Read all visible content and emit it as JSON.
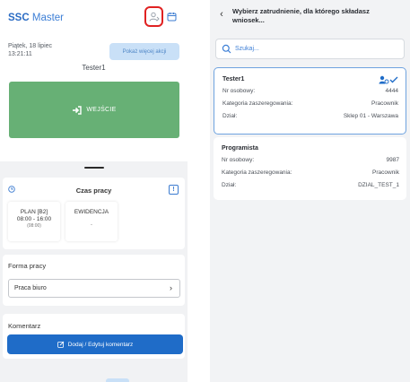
{
  "left_screen": {
    "brand_bold": "SSC",
    "brand_light": "Master",
    "date": "Piątek, 18 lipiec",
    "time": "13:21:11",
    "more_actions_label": "Pokaż więcej akcji",
    "user_name": "Tester1",
    "enter_label": "WEJŚCIE",
    "work_time": {
      "title": "Czas pracy",
      "info_label": "!",
      "plan_label": "PLAN [B2]",
      "plan_hours": "08:00 - 16:00",
      "plan_duration": "(08:00)",
      "evidence_label": "EWIDENCJA",
      "evidence_value": "-"
    },
    "work_form": {
      "title": "Forma pracy",
      "selected": "Praca biuro"
    },
    "comment": {
      "title": "Komentarz",
      "button_label": "Dodaj / Edytuj komentarz"
    }
  },
  "right_screen": {
    "title": "Wybierz zatrudnienie, dla którego składasz wniosek...",
    "search_placeholder": "Szukaj...",
    "employments": [
      {
        "name": "Tester1",
        "selected": true,
        "rows": [
          {
            "label": "Nr osobowy:",
            "value": "4444"
          },
          {
            "label": "Kategoria zaszeregowania:",
            "value": "Pracownik"
          },
          {
            "label": "Dział:",
            "value": "Sklep 01 - Warszawa"
          }
        ]
      },
      {
        "name": "Programista",
        "selected": false,
        "rows": [
          {
            "label": "Nr osobowy:",
            "value": "9987"
          },
          {
            "label": "Kategoria zaszeregowania:",
            "value": "Pracownik"
          },
          {
            "label": "Dział:",
            "value": "DZIAL_TEST_1"
          }
        ]
      }
    ]
  },
  "colors": {
    "brand_blue": "#2b6cc4",
    "enter_green": "#67b075",
    "primary_button": "#1f6cc8",
    "highlight_red": "#e02222",
    "selected_border": "#6fa3df"
  },
  "icons": [
    "user-switch-icon",
    "calendar-icon",
    "login-icon",
    "clock-icon",
    "info-icon",
    "chevron-right-icon",
    "edit-icon",
    "back-arrow-icon",
    "search-icon",
    "user-check-icon"
  ]
}
